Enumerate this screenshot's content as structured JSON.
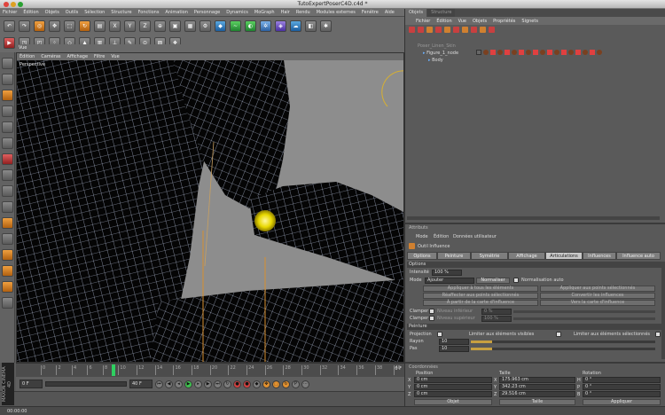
{
  "window": {
    "title": "TutoExpertPoserC4D.c4d *"
  },
  "menu": [
    "Fichier",
    "Édition",
    "Objets",
    "Outils",
    "Sélection",
    "Structure",
    "Fonctions",
    "Animation",
    "Personnage",
    "Dynamics",
    "MoGraph",
    "Hair",
    "Rendu",
    "Modules externes",
    "Fenêtre",
    "Aide"
  ],
  "viewport": {
    "title": "Vue",
    "menu": [
      "Édition",
      "Caméras",
      "Affichage",
      "Filtre",
      "Vue"
    ],
    "camera_label": "Perspective"
  },
  "timeline": {
    "ticks": [
      "0",
      "2",
      "4",
      "6",
      "8",
      "10",
      "12",
      "14",
      "16",
      "18",
      "20",
      "22",
      "24",
      "26",
      "28",
      "30",
      "32",
      "34",
      "36",
      "38",
      "40"
    ],
    "current_frame": "0 F",
    "end_frame": "40 F",
    "frame_field": "0 F"
  },
  "status": {
    "text": "00:00:00"
  },
  "logo": "MAXON CINEMA 4D",
  "objects_panel": {
    "tabs": [
      "Objets",
      "Structure"
    ],
    "menu": [
      "Fichier",
      "Édition",
      "Vue",
      "Objets",
      "Propriétés",
      "Signets"
    ],
    "tree": [
      {
        "name": "Poser_Linen_Skin",
        "indent": 0
      },
      {
        "name": "Figure_1_node",
        "indent": 1
      },
      {
        "name": "Body",
        "indent": 2
      }
    ]
  },
  "attributes": {
    "title": "Attributs",
    "menu": [
      "Mode",
      "Édition",
      "Données utilisateur"
    ],
    "tool_name": "Outil Influence",
    "tabs": [
      "Options",
      "Peinture",
      "Symétrie",
      "Affichage",
      "Articulations",
      "Influences",
      "Influence auto"
    ],
    "active_tab": "Articulations",
    "section_options": "Options",
    "intensity_label": "Intensité",
    "intensity_value": "100 %",
    "mode_label": "Mode",
    "mode_value": "Ajouter",
    "normaliser": "Normaliser",
    "normalisation_auto": "Normalisation auto",
    "btn_apply_all": "Appliquer à tous les éléments",
    "btn_apply_selected": "Appliquer aux points sélectionnés",
    "btn_apply_selected_elements": "Réaffecter aux points sélectionnés",
    "btn_convert": "Convertir les influences",
    "btn_from_map": "À partir de la carte d'influence",
    "btn_to_map": "Vers la carte d'influence",
    "clamp_low_label": "Clamper",
    "clamp_low_text": "Niveau inférieur",
    "clamp_low_value": "0 %",
    "clamp_high_label": "Clamper",
    "clamp_high_text": "Niveau supérieur",
    "clamp_high_value": "100 %",
    "section_paint": "Peinture",
    "projection_label": "Projection",
    "limit_visible": "Limiter aux éléments visibles",
    "limit_selected": "Limiter aux éléments sélectionnés",
    "radius_label": "Rayon",
    "radius_value": "10",
    "pressure_label": "Pas",
    "pressure_value": "10"
  },
  "coordinates": {
    "title": "Coordonnées",
    "col_position": "Position",
    "col_size": "Taille",
    "col_rotation": "Rotation",
    "rows": [
      {
        "axis": "X",
        "pos": "0 cm",
        "size_axis": "X",
        "size": "175.963 cm",
        "rot_axis": "H",
        "rot": "0 °"
      },
      {
        "axis": "Y",
        "pos": "0 cm",
        "size_axis": "Y",
        "size": "342.23 cm",
        "rot_axis": "P",
        "rot": "0 °"
      },
      {
        "axis": "Z",
        "pos": "0 cm",
        "size_axis": "Z",
        "size": "29.516 cm",
        "rot_axis": "B",
        "rot": "0 °"
      }
    ],
    "mode_left": "Objet",
    "mode_right": "Taille",
    "apply_button": "Appliquer"
  }
}
